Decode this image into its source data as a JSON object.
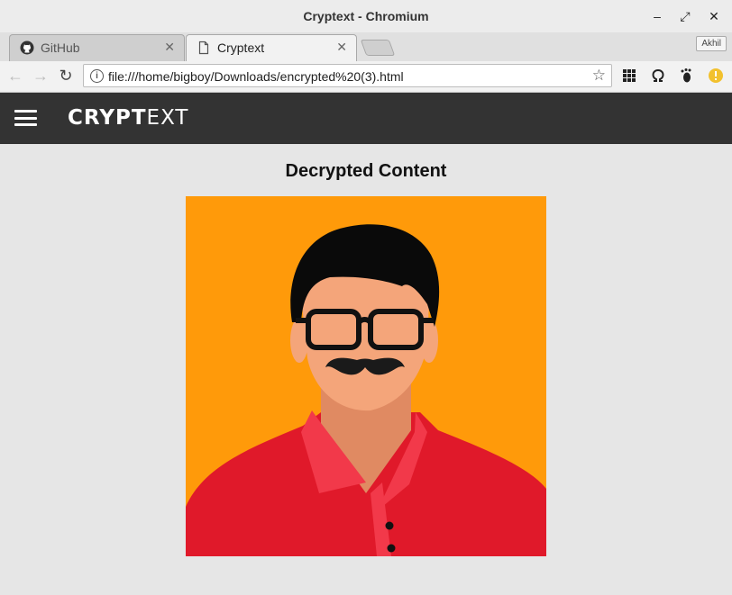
{
  "window": {
    "title": "Cryptext - Chromium"
  },
  "tabs": [
    {
      "label": "GitHub",
      "icon": "github-icon",
      "active": false
    },
    {
      "label": "Cryptext",
      "icon": "document-icon",
      "active": true
    }
  ],
  "profile": {
    "name": "Akhil"
  },
  "address_bar": {
    "url": "file:///home/bigboy/Downloads/encrypted%20(3).html"
  },
  "app": {
    "logo_bold": "CRYPT",
    "logo_light": "EXT"
  },
  "content": {
    "heading": "Decrypted Content",
    "image_alt_colors": {
      "background": "#ff9a0a",
      "shirt": "#e0192a",
      "skin": "#f4a57a",
      "hair": "#0a0a0a"
    }
  }
}
